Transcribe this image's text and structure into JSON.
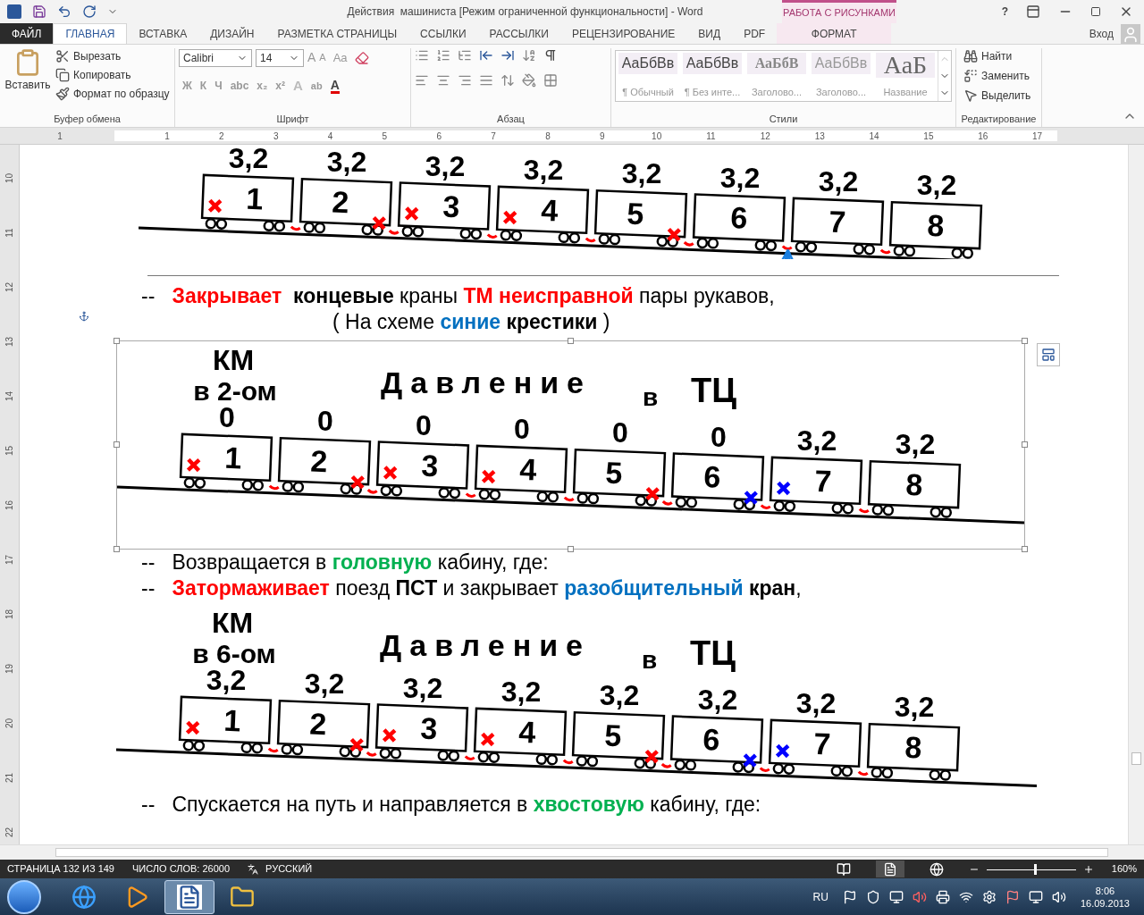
{
  "title_bar": {
    "title": "Действия  машиниста [Режим ограниченной функциональности] - Word",
    "context_label": "РАБОТА С РИСУНКАМИ",
    "help": "?"
  },
  "tabs": [
    {
      "label": "ФАЙЛ",
      "kind": "file",
      "selected": false
    },
    {
      "label": "ГЛАВНАЯ",
      "kind": "normal",
      "selected": true
    },
    {
      "label": "ВСТАВКА",
      "kind": "normal",
      "selected": false
    },
    {
      "label": "ДИЗАЙН",
      "kind": "normal",
      "selected": false
    },
    {
      "label": "РАЗМЕТКА СТРАНИЦЫ",
      "kind": "normal",
      "selected": false
    },
    {
      "label": "ССЫЛКИ",
      "kind": "normal",
      "selected": false
    },
    {
      "label": "РАССЫЛКИ",
      "kind": "normal",
      "selected": false
    },
    {
      "label": "РЕЦЕНЗИРОВАНИЕ",
      "kind": "normal",
      "selected": false
    },
    {
      "label": "ВИД",
      "kind": "normal",
      "selected": false
    },
    {
      "label": "PDF",
      "kind": "normal",
      "selected": false
    },
    {
      "label": "ФОРМАТ",
      "kind": "context",
      "selected": false
    }
  ],
  "account": {
    "label": "Вход"
  },
  "ribbon": {
    "clipboard": {
      "title": "Буфер обмена",
      "paste": "Вставить",
      "items": [
        {
          "kind": "cut",
          "label": "Вырезать"
        },
        {
          "kind": "copy",
          "label": "Копировать"
        },
        {
          "kind": "painter",
          "label": "Формат по образцу"
        }
      ]
    },
    "font": {
      "title": "Шрифт",
      "family": "Calibri",
      "size": "14",
      "grow": "A",
      "shrink": "A",
      "case": "Aa",
      "styles": [
        "Ж",
        "К",
        "Ч",
        "abc",
        "x₂",
        "x²"
      ],
      "effects": "A",
      "highlight": "ab",
      "color_letter": "A"
    },
    "paragraph": {
      "title": "Абзац"
    },
    "styles": {
      "title": "Стили",
      "items": [
        {
          "sample": "АаБбВв",
          "name": "¶ Обычный",
          "kind": "plain"
        },
        {
          "sample": "АаБбВв",
          "name": "¶ Без инте...",
          "kind": "plain"
        },
        {
          "sample": "АаБбВ",
          "name": "Заголово...",
          "kind": "heading"
        },
        {
          "sample": "АаБбВв",
          "name": "Заголово...",
          "kind": "subtle"
        },
        {
          "sample": "АаБ",
          "name": "Название",
          "kind": "title"
        }
      ]
    },
    "editing": {
      "title": "Редактирование",
      "items": [
        {
          "kind": "find",
          "label": "Найти"
        },
        {
          "kind": "replace",
          "label": "Заменить"
        },
        {
          "kind": "select",
          "label": "Выделить"
        }
      ]
    }
  },
  "ruler": {
    "horizontal": [
      "1",
      "1",
      "2",
      "3",
      "4",
      "5",
      "6",
      "7",
      "8",
      "9",
      "10",
      "11",
      "12",
      "13",
      "14",
      "15",
      "16",
      "17"
    ],
    "vertical": [
      "10",
      "11",
      "12",
      "13",
      "14",
      "15",
      "16",
      "17",
      "18",
      "19",
      "20",
      "21",
      "22"
    ]
  },
  "document": {
    "blocks": [
      {
        "kind": "diagram",
        "selected": false,
        "wagons": [
          {
            "number": "1",
            "pressure": "3,2",
            "crosses": [
              {
                "kind": "left",
                "color": "#ff0000"
              }
            ]
          },
          {
            "number": "2",
            "pressure": "3,2",
            "crosses": [
              {
                "kind": "right",
                "color": "#ff0000"
              }
            ]
          },
          {
            "number": "3",
            "pressure": "3,2",
            "crosses": [
              {
                "kind": "left",
                "color": "#ff0000"
              }
            ]
          },
          {
            "number": "4",
            "pressure": "3,2",
            "crosses": [
              {
                "kind": "left",
                "color": "#ff0000"
              }
            ]
          },
          {
            "number": "5",
            "pressure": "3,2",
            "crosses": [
              {
                "kind": "right",
                "color": "#ff0000"
              }
            ]
          },
          {
            "number": "6",
            "pressure": "3,2",
            "venting": true
          },
          {
            "number": "7",
            "pressure": "3,2"
          },
          {
            "number": "8",
            "pressure": "3,2"
          }
        ]
      },
      {
        "kind": "rule"
      },
      {
        "kind": "paragraph",
        "segments": [
          {
            "text": "--   ",
            "bold": false
          },
          {
            "text": "Закрывает ",
            "bold": true,
            "color": "#ff0000"
          },
          {
            "text": " концевые",
            "bold": true
          },
          {
            "text": " краны ",
            "bold": false
          },
          {
            "text": "ТМ неисправной",
            "bold": true,
            "color": "#ff0000"
          },
          {
            "text": " пары рукавов,",
            "bold": false
          }
        ]
      },
      {
        "kind": "indented_paragraph",
        "segments": [
          {
            "text": "( На схеме ",
            "bold": false
          },
          {
            "text": "синие",
            "bold": true,
            "color": "#0070c0"
          },
          {
            "text": " крестики ",
            "bold": true
          },
          {
            "text": ")",
            "bold": false
          }
        ]
      },
      {
        "kind": "diagram",
        "selected": true,
        "km": [
          "КМ",
          "в 2-ом"
        ],
        "heading": [
          "Давление",
          "в",
          "ТЦ"
        ],
        "wagons": [
          {
            "number": "1",
            "pressure": "0",
            "crosses": [
              {
                "kind": "left",
                "color": "#ff0000"
              }
            ]
          },
          {
            "number": "2",
            "pressure": "0",
            "crosses": [
              {
                "kind": "right",
                "color": "#ff0000"
              }
            ]
          },
          {
            "number": "3",
            "pressure": "0",
            "crosses": [
              {
                "kind": "left",
                "color": "#ff0000"
              }
            ]
          },
          {
            "number": "4",
            "pressure": "0",
            "crosses": [
              {
                "kind": "left",
                "color": "#ff0000"
              }
            ]
          },
          {
            "number": "5",
            "pressure": "0",
            "crosses": [
              {
                "kind": "right",
                "color": "#ff0000"
              }
            ]
          },
          {
            "number": "6",
            "pressure": "0",
            "crosses": [
              {
                "kind": "right",
                "color": "#0000ff"
              }
            ]
          },
          {
            "number": "7",
            "pressure": "3,2",
            "crosses": [
              {
                "kind": "left",
                "color": "#0000ff"
              }
            ]
          },
          {
            "number": "8",
            "pressure": "3,2"
          }
        ]
      },
      {
        "kind": "paragraph",
        "segments": [
          {
            "text": "--   Возвращается в ",
            "bold": false
          },
          {
            "text": "головную",
            "bold": true,
            "color": "#00b050"
          },
          {
            "text": " кабину, где:",
            "bold": false
          }
        ]
      },
      {
        "kind": "paragraph",
        "segments": [
          {
            "text": "--   ",
            "bold": false
          },
          {
            "text": "Затормаживает",
            "bold": true,
            "color": "#ff0000"
          },
          {
            "text": " поезд ",
            "bold": false
          },
          {
            "text": "ПСТ",
            "bold": true
          },
          {
            "text": " и закрывает ",
            "bold": false
          },
          {
            "text": "разобщительный",
            "bold": true,
            "color": "#0070c0"
          },
          {
            "text": " кран",
            "bold": true
          },
          {
            "text": ",",
            "bold": false
          }
        ]
      },
      {
        "kind": "diagram",
        "selected": false,
        "km": [
          "КМ",
          "в 6-ом"
        ],
        "heading": [
          "Давление",
          "в",
          "ТЦ"
        ],
        "wagons": [
          {
            "number": "1",
            "pressure": "3,2",
            "crosses": [
              {
                "kind": "left",
                "color": "#ff0000"
              }
            ]
          },
          {
            "number": "2",
            "pressure": "3,2",
            "crosses": [
              {
                "kind": "right",
                "color": "#ff0000"
              }
            ]
          },
          {
            "number": "3",
            "pressure": "3,2",
            "crosses": [
              {
                "kind": "left",
                "color": "#ff0000"
              }
            ]
          },
          {
            "number": "4",
            "pressure": "3,2",
            "crosses": [
              {
                "kind": "left",
                "color": "#ff0000"
              }
            ]
          },
          {
            "number": "5",
            "pressure": "3,2",
            "crosses": [
              {
                "kind": "right",
                "color": "#ff0000"
              }
            ]
          },
          {
            "number": "6",
            "pressure": "3,2",
            "crosses": [
              {
                "kind": "right",
                "color": "#0000ff"
              }
            ]
          },
          {
            "number": "7",
            "pressure": "3,2",
            "crosses": [
              {
                "kind": "left",
                "color": "#0000ff"
              }
            ]
          },
          {
            "number": "8",
            "pressure": "3,2"
          }
        ]
      },
      {
        "kind": "paragraph",
        "segments": [
          {
            "text": "--   Спускается на путь и направляется в ",
            "bold": false
          },
          {
            "text": "хвостовую",
            "bold": true,
            "color": "#00b050"
          },
          {
            "text": " кабину, где:",
            "bold": false
          }
        ]
      }
    ]
  },
  "status_bar": {
    "page": "СТРАНИЦА 132 ИЗ 149",
    "words": "ЧИСЛО СЛОВ: 26000",
    "language": "РУССКИЙ",
    "view_modes": [
      {
        "kind": "read",
        "selected": false
      },
      {
        "kind": "print",
        "selected": true
      },
      {
        "kind": "web",
        "selected": false
      }
    ],
    "zoom": {
      "level": 0.55,
      "label": "160%"
    }
  },
  "taskbar": {
    "apps": [
      {
        "kind": "ie",
        "selected": false
      },
      {
        "kind": "media",
        "selected": false
      },
      {
        "kind": "word",
        "selected": true
      },
      {
        "kind": "explorer",
        "selected": false
      }
    ],
    "language": "RU",
    "time": "8:06",
    "date": "16.09.2013"
  }
}
